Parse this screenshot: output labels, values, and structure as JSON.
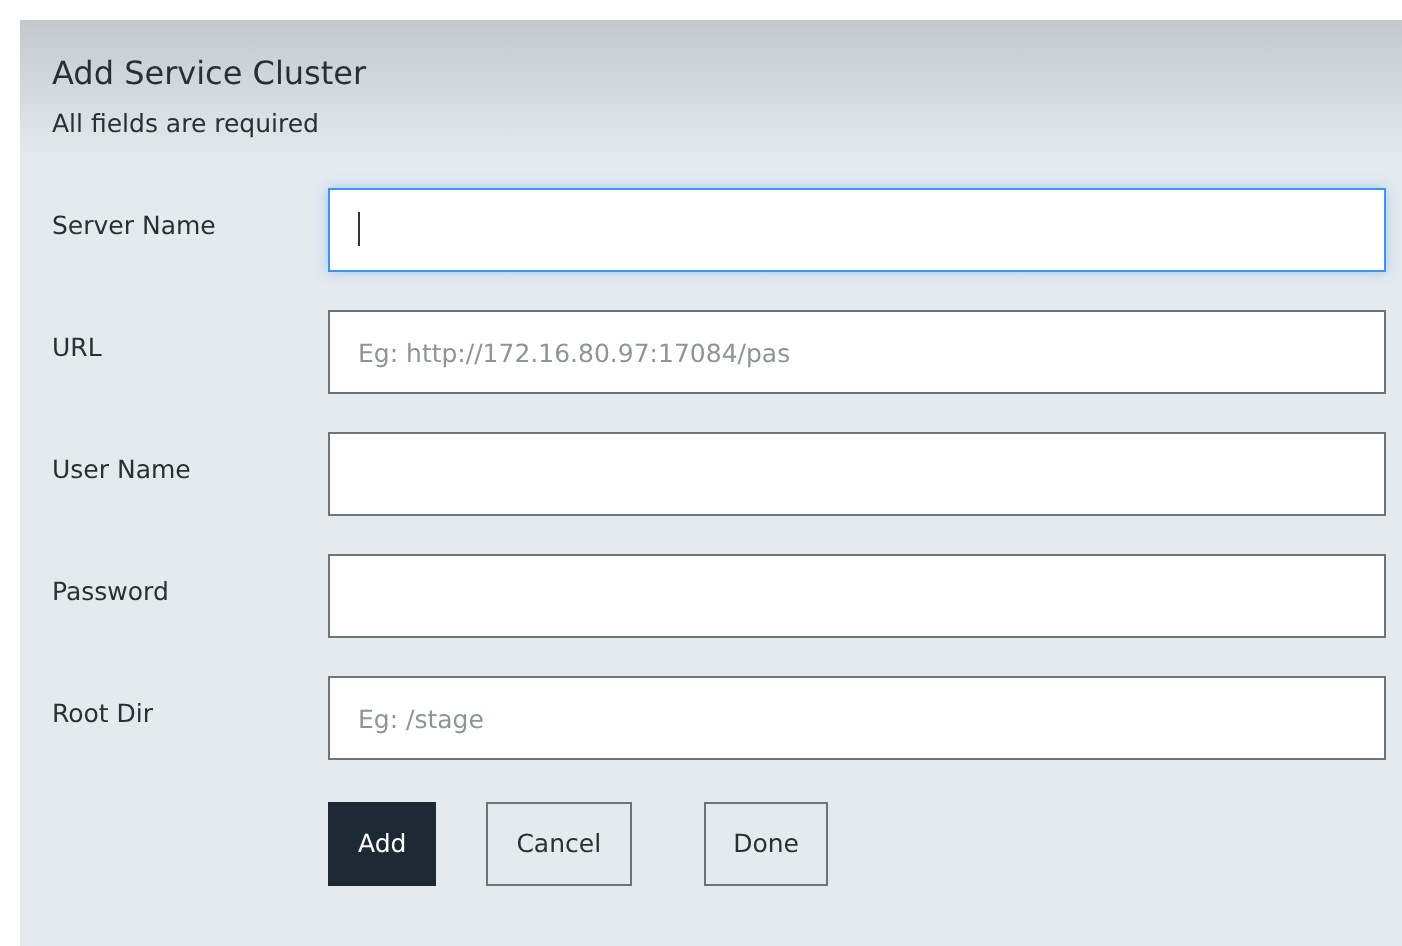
{
  "dialog": {
    "title": "Add Service Cluster",
    "subtitle": "All fields are required"
  },
  "fields": [
    {
      "label": "Server Name",
      "focused": true
    },
    {
      "label": "URL",
      "placeholder": "Eg: http://172.16.80.97:17084/pas",
      "focused": false
    },
    {
      "label": "User Name",
      "focused": false
    },
    {
      "label": "Password",
      "focused": false
    },
    {
      "label": "Root Dir",
      "placeholder": "Eg: /stage",
      "focused": false
    }
  ],
  "buttons": [
    {
      "label": "Add",
      "kind": "primary"
    },
    {
      "label": "Cancel",
      "kind": "secondary"
    },
    {
      "label": "Done",
      "kind": "secondary"
    }
  ]
}
